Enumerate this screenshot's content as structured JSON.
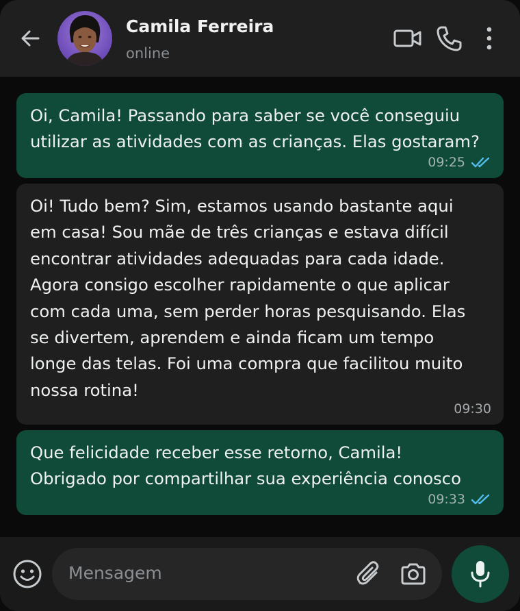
{
  "contact": {
    "name": "Camila Ferreira",
    "status": "online"
  },
  "icons": {
    "back": "arrow-left-icon",
    "video": "video-camera-icon",
    "call": "phone-icon",
    "more": "more-vertical-icon",
    "emoji": "smiley-icon",
    "attach": "paperclip-icon",
    "camera": "camera-icon",
    "mic": "microphone-icon"
  },
  "colors": {
    "header_bg": "#1f1f1f",
    "chat_bg": "#0a0a0a",
    "outgoing_bubble": "#0f4b38",
    "incoming_bubble": "#1f1f1f",
    "read_ticks": "#53bdeb",
    "mic_button": "#0f4b38"
  },
  "messages": [
    {
      "direction": "outgoing",
      "text": "Oi, Camila! Passando para saber se você conseguiu\nutilizar as atividades com as crianças. Elas gostaram?",
      "time": "09:25",
      "read": true
    },
    {
      "direction": "incoming",
      "text": "Oi! Tudo bem? Sim, estamos usando bastante aqui\nem casa! Sou mãe de três crianças e estava difícil\nencontrar atividades adequadas para cada idade.\nAgora consigo escolher rapidamente o que aplicar\ncom cada uma, sem perder horas pesquisando. Elas\nse divertem, aprendem e ainda ficam um tempo\nlonge das telas. Foi uma compra que facilitou muito\nnossa rotina!",
      "time": "09:30",
      "read": false
    },
    {
      "direction": "outgoing",
      "text": "Que felicidade receber esse retorno, Camila!\nObrigado por compartilhar sua experiência conosco",
      "time": "09:33",
      "read": true
    }
  ],
  "composer": {
    "placeholder": "Mensagem"
  }
}
